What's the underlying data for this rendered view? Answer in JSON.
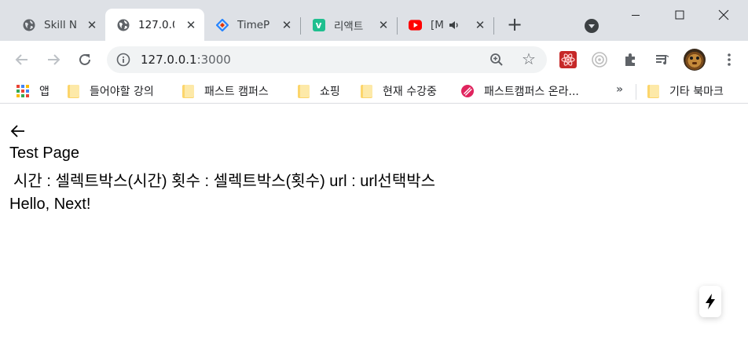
{
  "tabs": [
    {
      "title": "Skill N",
      "active": false,
      "favicon": "globe-icon"
    },
    {
      "title": "127.0.0",
      "active": true,
      "favicon": "globe-icon"
    },
    {
      "title": "TimeP",
      "active": false,
      "favicon": "timepay-diamond-icon"
    },
    {
      "title": "리액트",
      "active": false,
      "favicon": "v-green-icon"
    },
    {
      "title": "[M",
      "active": false,
      "favicon": "youtube-icon",
      "audio": true
    }
  ],
  "address_bar": {
    "host": "127.0.0.1",
    "port": ":3000"
  },
  "bookmarks": [
    {
      "label": "앱",
      "icon": "apps-grid-icon"
    },
    {
      "label": "들어야할 강의",
      "icon": "folder-icon"
    },
    {
      "label": "패스트 캠퍼스",
      "icon": "folder-icon"
    },
    {
      "label": "쇼핑",
      "icon": "folder-icon"
    },
    {
      "label": "현재 수강중",
      "icon": "folder-icon"
    },
    {
      "label": "패스트캠퍼스 온라...",
      "icon": "fastcampus-logo-icon"
    },
    {
      "label": "기타 북마크",
      "icon": "folder-icon"
    }
  ],
  "bookmarks_more": "»",
  "page": {
    "title": "Test Page",
    "select_line": "시간 : 셀렉트박스(시간) 횟수 : 셀렉트박스(횟수) url : url선택박스",
    "greeting": "Hello, Next!"
  },
  "colors": {
    "tabstrip_bg": "#dee1e6",
    "omnibox_bg": "#f1f3f4",
    "youtube_red": "#ff0000",
    "v_green": "#1fbf8f",
    "folder_yellow": "#fcd56b",
    "fastcampus_red": "#e0245e"
  }
}
